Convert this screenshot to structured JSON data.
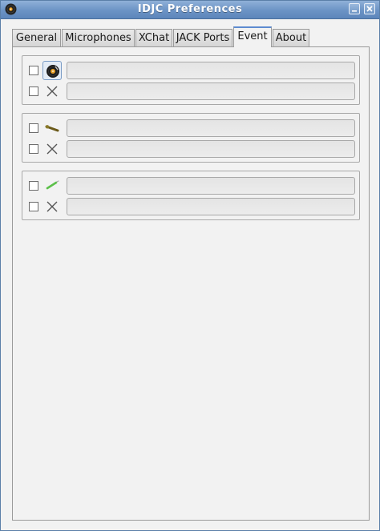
{
  "window": {
    "title": "IDJC Preferences",
    "accent": "#6b93c5"
  },
  "tabs": [
    {
      "label": "General"
    },
    {
      "label": "Microphones"
    },
    {
      "label": "XChat"
    },
    {
      "label": "JACK Ports"
    },
    {
      "label": "Event"
    },
    {
      "label": "About"
    }
  ],
  "active_tab": "Event",
  "event_groups": [
    {
      "rows": [
        {
          "checked": false,
          "icon": "vinyl-record-icon",
          "value": ""
        },
        {
          "checked": false,
          "icon": "cross-icon",
          "value": ""
        }
      ]
    },
    {
      "rows": [
        {
          "checked": false,
          "icon": "microphone-icon",
          "value": ""
        },
        {
          "checked": false,
          "icon": "cross-icon",
          "value": ""
        }
      ]
    },
    {
      "rows": [
        {
          "checked": false,
          "icon": "microphone-green-icon",
          "value": ""
        },
        {
          "checked": false,
          "icon": "cross-icon",
          "value": ""
        }
      ]
    }
  ]
}
